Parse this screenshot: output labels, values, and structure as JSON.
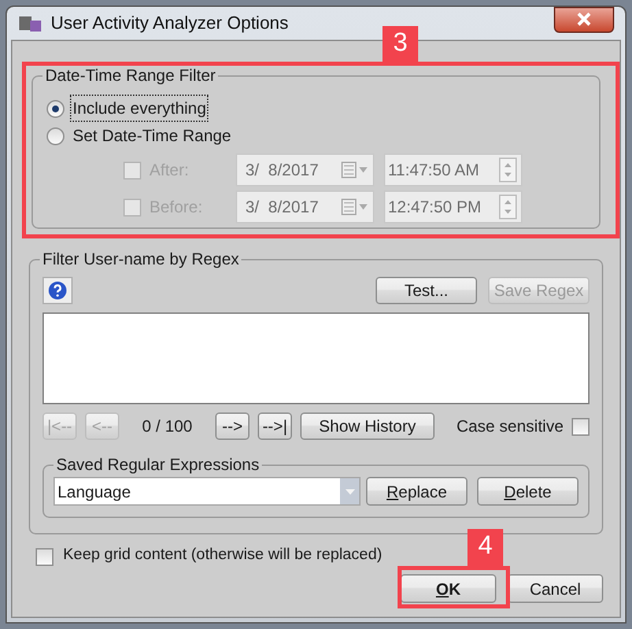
{
  "window": {
    "title": "User Activity Analyzer Options"
  },
  "date_time_filter": {
    "title": "Date-Time Range Filter",
    "radios": [
      {
        "label": "Include everything",
        "selected": true
      },
      {
        "label": "Set Date-Time Range",
        "selected": false
      }
    ],
    "ranges": [
      {
        "label": "After:",
        "checked": false,
        "disabled": true,
        "date": "3/  8/2017",
        "time": "11:47:50 AM"
      },
      {
        "label": "Before:",
        "checked": false,
        "disabled": true,
        "date": "3/  8/2017",
        "time": "12:47:50 PM"
      }
    ]
  },
  "regex_filter": {
    "title": "Filter User-name by Regex",
    "buttons": [
      {
        "label": "Test...",
        "disabled": false
      },
      {
        "label": "Save Regex",
        "disabled": true
      }
    ],
    "nav_buttons": [
      {
        "label": "|<--",
        "disabled": true
      },
      {
        "label": "<--",
        "disabled": true
      },
      {
        "label": "-->",
        "disabled": false
      },
      {
        "label": "-->|",
        "disabled": false
      }
    ],
    "counter": "0 / 100",
    "show_history": "Show History",
    "case_sensitive": {
      "label": "Case sensitive",
      "checked": false
    },
    "saved": {
      "title": "Saved Regular Expressions",
      "value": "Language",
      "buttons": [
        {
          "label": "Replace",
          "mnemonic_first": true
        },
        {
          "label": "Delete",
          "mnemonic_first": true
        }
      ]
    }
  },
  "keep_grid": {
    "label": "Keep grid content (otherwise will be replaced)",
    "checked": false
  },
  "footer_buttons": [
    {
      "label": "OK",
      "default": true,
      "mnemonic_first": true
    },
    {
      "label": "Cancel",
      "default": false,
      "mnemonic_first": false
    }
  ],
  "annotations": [
    {
      "label": "3"
    },
    {
      "label": "4"
    }
  ]
}
